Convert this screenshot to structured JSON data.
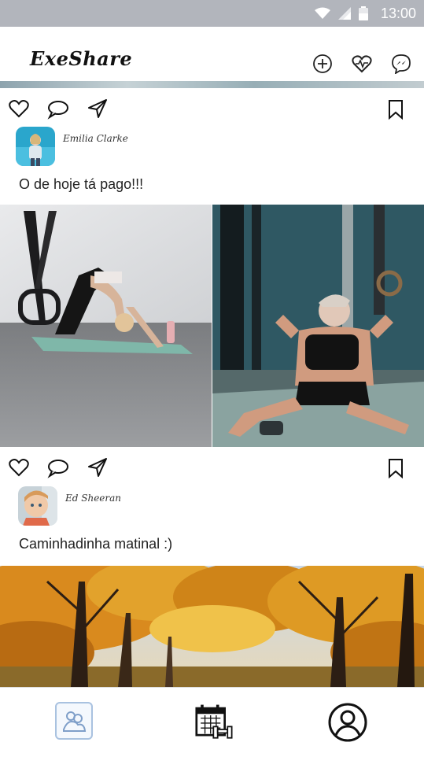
{
  "status_bar": {
    "time": "13:00"
  },
  "header": {
    "app_title": "ExeShare",
    "icons": [
      "add-circle-icon",
      "heart-pulse-icon",
      "messenger-icon"
    ]
  },
  "posts": [
    {
      "author": "Emilia Clarke",
      "caption": "O de hoje tá pago!!!",
      "images": [
        "yoga-downward-dog-photo",
        "crossfit-situp-photo"
      ]
    },
    {
      "author": "Ed Sheeran",
      "caption": "Caminhadinha matinal :)",
      "images": [
        "autumn-forest-photo"
      ]
    }
  ],
  "bottom_nav": {
    "items": [
      "community-icon",
      "calendar-workout-icon",
      "profile-icon"
    ],
    "active": "community-icon"
  },
  "colors": {
    "status_bar": "#b2b5bc",
    "nav_active_border": "#a9c2e0"
  }
}
